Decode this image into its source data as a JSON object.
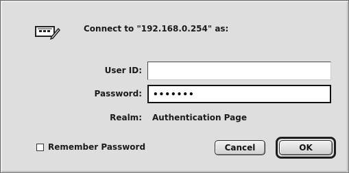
{
  "dialog": {
    "title": "Connect to \"192.168.0.254\" as:",
    "icon": "server-connection-icon"
  },
  "form": {
    "user_id_label": "User ID:",
    "user_id_value": "",
    "password_label": "Password:",
    "password_value": "•••••••",
    "realm_label": "Realm:",
    "realm_value": "Authentication Page"
  },
  "options": {
    "remember_label": "Remember Password",
    "remember_checked": false
  },
  "buttons": {
    "cancel_label": "Cancel",
    "ok_label": "OK"
  }
}
